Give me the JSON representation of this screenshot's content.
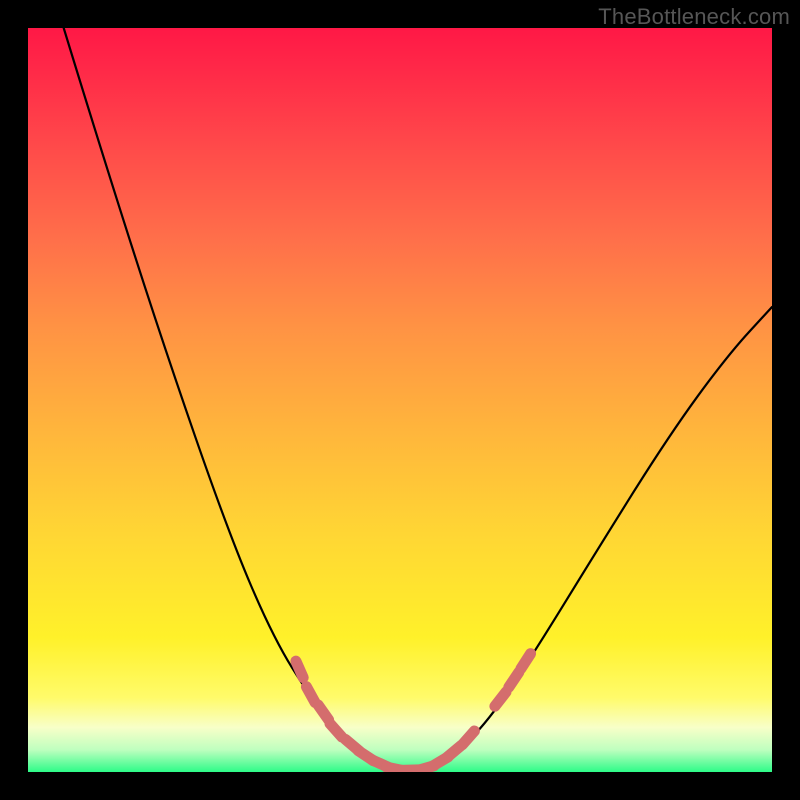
{
  "watermark": "TheBottleneck.com",
  "chart_data": {
    "type": "line",
    "title": "",
    "xlabel": "",
    "ylabel": "",
    "xlim": [
      0,
      100
    ],
    "ylim": [
      0,
      100
    ],
    "series": [
      {
        "name": "curve",
        "color": "#000000",
        "points": [
          {
            "x": 4.8,
            "y": 100.0
          },
          {
            "x": 10.0,
            "y": 83.0
          },
          {
            "x": 18.0,
            "y": 58.0
          },
          {
            "x": 27.0,
            "y": 32.0
          },
          {
            "x": 33.0,
            "y": 18.0
          },
          {
            "x": 38.0,
            "y": 10.0
          },
          {
            "x": 42.0,
            "y": 5.0
          },
          {
            "x": 46.0,
            "y": 1.6
          },
          {
            "x": 49.5,
            "y": 0.2
          },
          {
            "x": 53.0,
            "y": 0.2
          },
          {
            "x": 57.0,
            "y": 2.0
          },
          {
            "x": 62.0,
            "y": 7.0
          },
          {
            "x": 68.0,
            "y": 16.0
          },
          {
            "x": 76.0,
            "y": 29.0
          },
          {
            "x": 86.0,
            "y": 45.0
          },
          {
            "x": 94.0,
            "y": 56.0
          },
          {
            "x": 100.0,
            "y": 62.5
          }
        ]
      },
      {
        "name": "markers",
        "color": "#d46d6d",
        "points": [
          {
            "x": 36.5,
            "y": 13.8
          },
          {
            "x": 38.0,
            "y": 10.4
          },
          {
            "x": 39.7,
            "y": 8.0
          },
          {
            "x": 41.4,
            "y": 5.6
          },
          {
            "x": 43.6,
            "y": 3.6
          },
          {
            "x": 45.4,
            "y": 2.2
          },
          {
            "x": 47.4,
            "y": 1.1
          },
          {
            "x": 49.4,
            "y": 0.4
          },
          {
            "x": 51.4,
            "y": 0.25
          },
          {
            "x": 53.4,
            "y": 0.5
          },
          {
            "x": 55.4,
            "y": 1.4
          },
          {
            "x": 57.3,
            "y": 2.8
          },
          {
            "x": 59.2,
            "y": 4.6
          },
          {
            "x": 63.5,
            "y": 9.8
          },
          {
            "x": 65.3,
            "y": 12.4
          },
          {
            "x": 66.9,
            "y": 14.9
          }
        ]
      }
    ],
    "gradient_stops": [
      {
        "pos": 0,
        "color": "#ff1846"
      },
      {
        "pos": 6,
        "color": "#ff2a48"
      },
      {
        "pos": 16,
        "color": "#ff4a4a"
      },
      {
        "pos": 28,
        "color": "#ff6e4a"
      },
      {
        "pos": 40,
        "color": "#ff9244"
      },
      {
        "pos": 54,
        "color": "#ffb53c"
      },
      {
        "pos": 68,
        "color": "#ffd634"
      },
      {
        "pos": 82,
        "color": "#fff12a"
      },
      {
        "pos": 90,
        "color": "#fffb6a"
      },
      {
        "pos": 94,
        "color": "#f8ffc8"
      },
      {
        "pos": 97,
        "color": "#bfffbf"
      },
      {
        "pos": 100,
        "color": "#2dfb88"
      }
    ]
  }
}
